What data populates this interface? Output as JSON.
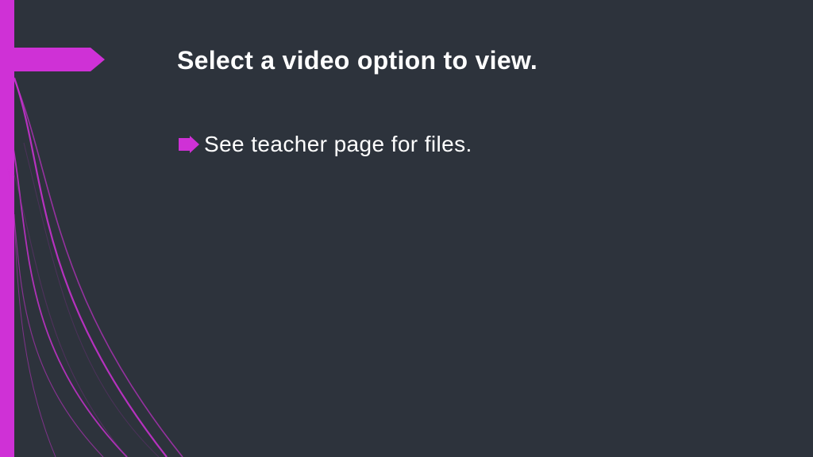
{
  "colors": {
    "background": "#2d333c",
    "accent": "#cf31d6",
    "text": "#ffffff"
  },
  "title": "Select a video option to view.",
  "body": {
    "items": [
      {
        "text": "See teacher page for files."
      }
    ]
  }
}
